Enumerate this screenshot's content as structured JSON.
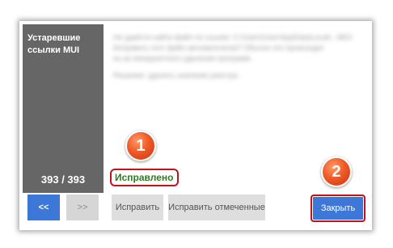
{
  "sidebar": {
    "title": "Устаревшие ссылки MUI",
    "counter": "393 / 393"
  },
  "content": {
    "line1": "Не удаётся найти файл по ссылке: C:\\Users\\User\\AppData\\Local\\...\\MUI",
    "line2": "Исправить этот файл автоматически? Обычно это происходит",
    "line3": "из-за некорректного удаления программ.",
    "line4": "Решение: удалить значение реестра."
  },
  "status": {
    "text": "Исправлено"
  },
  "buttons": {
    "prev": "<<",
    "next": ">>",
    "fix": "Исправить",
    "fix_selected": "Исправить отмеченные",
    "close": "Закрыть"
  },
  "markers": {
    "first": "1",
    "second": "2"
  },
  "colors": {
    "accent": "#3d77d8",
    "sidebar": "#666666",
    "highlight": "#c0141b",
    "status_ok": "#2e7d1f",
    "marker": "#f05a24"
  }
}
